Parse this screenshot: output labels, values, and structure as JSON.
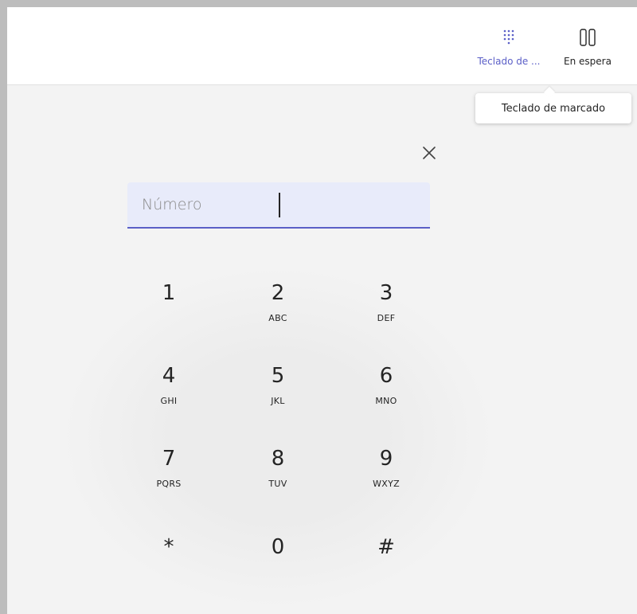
{
  "toolbar": {
    "dialpad_label": "Teclado de ...",
    "hold_label": "En espera",
    "dialpad_icon": "dialpad-icon",
    "hold_icon": "pause-icon",
    "accent_color": "#5b5fc7"
  },
  "tooltip": {
    "text": "Teclado de marcado"
  },
  "close_icon": "close-icon",
  "number_input": {
    "placeholder": "Número",
    "value": ""
  },
  "keypad": {
    "keys": [
      {
        "digit": "1",
        "letters": ""
      },
      {
        "digit": "2",
        "letters": "ABC"
      },
      {
        "digit": "3",
        "letters": "DEF"
      },
      {
        "digit": "4",
        "letters": "GHI"
      },
      {
        "digit": "5",
        "letters": "JKL"
      },
      {
        "digit": "6",
        "letters": "MNO"
      },
      {
        "digit": "7",
        "letters": "PQRS"
      },
      {
        "digit": "8",
        "letters": "TUV"
      },
      {
        "digit": "9",
        "letters": "WXYZ"
      },
      {
        "digit": "*",
        "letters": ""
      },
      {
        "digit": "0",
        "letters": ""
      },
      {
        "digit": "#",
        "letters": ""
      }
    ]
  }
}
